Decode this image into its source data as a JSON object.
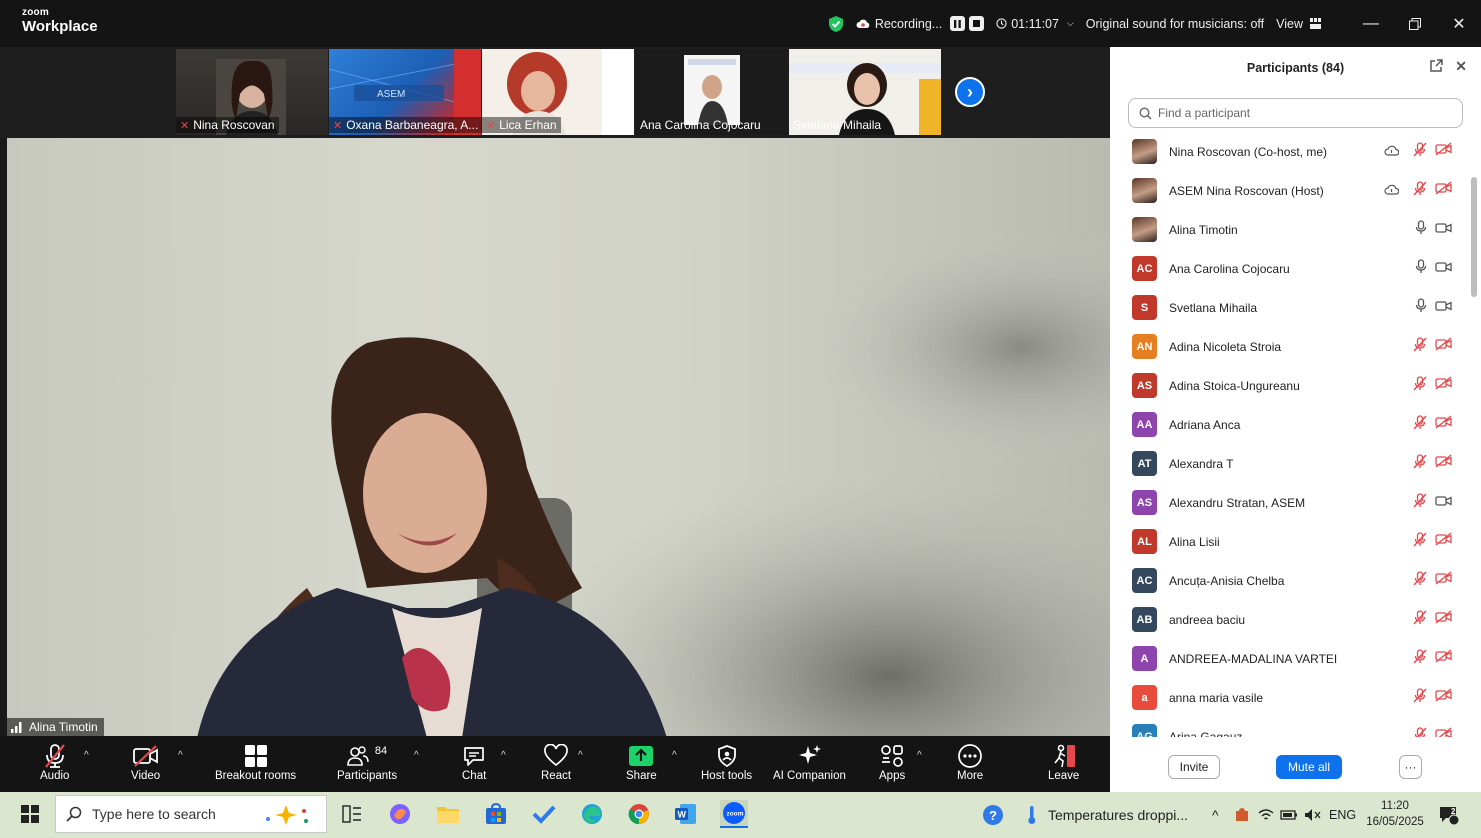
{
  "titlebar": {
    "brand_small": "zoom",
    "brand_big": "Workplace",
    "recording_label": "Recording...",
    "timer": "01:11:07",
    "sound_label": "Original sound for musicians: off",
    "view_label": "View"
  },
  "thumbnails": [
    {
      "label": "Nina Roscovan",
      "muted": true
    },
    {
      "label": "Oxana Barbaneagra, A...",
      "muted": true
    },
    {
      "label": "Lica Erhan",
      "muted": true
    },
    {
      "label": "Ana Carolina Cojocaru",
      "muted": false
    },
    {
      "label": "Svetlana Mihaila",
      "muted": false
    }
  ],
  "thumb_logo_text": "ASEM",
  "main_video": {
    "speaker": "Alina Timotin"
  },
  "toolbar": {
    "audio": "Audio",
    "video": "Video",
    "breakout": "Breakout rooms",
    "participants": "Participants",
    "participants_count": "84",
    "chat": "Chat",
    "react": "React",
    "share": "Share",
    "host_tools": "Host tools",
    "ai_companion": "AI Companion",
    "apps": "Apps",
    "more": "More",
    "leave": "Leave"
  },
  "panel": {
    "title": "Participants (84)",
    "search_placeholder": "Find a participant",
    "invite": "Invite",
    "mute_all": "Mute all",
    "more": "···",
    "participants": [
      {
        "name": "Nina Roscovan (Co-host, me)",
        "initials": "",
        "color": "",
        "photo": true,
        "cloud": true,
        "mic": "off",
        "cam": "off"
      },
      {
        "name": "ASEM Nina Roscovan (Host)",
        "initials": "",
        "color": "",
        "photo": true,
        "cloud": true,
        "mic": "off",
        "cam": "off"
      },
      {
        "name": "Alina Timotin",
        "initials": "",
        "color": "",
        "photo": true,
        "cloud": false,
        "mic": "on",
        "cam": "on"
      },
      {
        "name": "Ana Carolina Cojocaru",
        "initials": "AC",
        "color": "#c0392b",
        "photo": false,
        "cloud": false,
        "mic": "on",
        "cam": "on"
      },
      {
        "name": "Svetlana Mihaila",
        "initials": "S",
        "color": "#c0392b",
        "photo": false,
        "cloud": false,
        "mic": "on",
        "cam": "on"
      },
      {
        "name": "Adina Nicoleta Stroia",
        "initials": "AN",
        "color": "#e67e22",
        "photo": false,
        "cloud": false,
        "mic": "off",
        "cam": "off"
      },
      {
        "name": "Adina Stoica-Ungureanu",
        "initials": "AS",
        "color": "#c0392b",
        "photo": false,
        "cloud": false,
        "mic": "off",
        "cam": "off"
      },
      {
        "name": "Adriana Anca",
        "initials": "AA",
        "color": "#8e44ad",
        "photo": false,
        "cloud": false,
        "mic": "off",
        "cam": "off"
      },
      {
        "name": "Alexandra T",
        "initials": "AT",
        "color": "#34495e",
        "photo": false,
        "cloud": false,
        "mic": "off",
        "cam": "off"
      },
      {
        "name": "Alexandru Stratan, ASEM",
        "initials": "AS",
        "color": "#8e44ad",
        "photo": false,
        "cloud": false,
        "mic": "off",
        "cam": "on"
      },
      {
        "name": "Alina Lisii",
        "initials": "AL",
        "color": "#c0392b",
        "photo": false,
        "cloud": false,
        "mic": "off",
        "cam": "off"
      },
      {
        "name": "Ancuța-Anisia Chelba",
        "initials": "AC",
        "color": "#34495e",
        "photo": false,
        "cloud": false,
        "mic": "off",
        "cam": "off"
      },
      {
        "name": "andreea baciu",
        "initials": "AB",
        "color": "#34495e",
        "photo": false,
        "cloud": false,
        "mic": "off",
        "cam": "off"
      },
      {
        "name": "ANDREEA-MADALINA VARTEI",
        "initials": "A",
        "color": "#8e44ad",
        "photo": false,
        "cloud": false,
        "mic": "off",
        "cam": "off"
      },
      {
        "name": "anna maria vasile",
        "initials": "a",
        "color": "#e74c3c",
        "photo": false,
        "cloud": false,
        "mic": "off",
        "cam": "off"
      },
      {
        "name": "Arina Gagauz",
        "initials": "AG",
        "color": "#2980b9",
        "photo": false,
        "cloud": false,
        "mic": "off",
        "cam": "off"
      }
    ]
  },
  "taskbar": {
    "search_placeholder": "Type here to search",
    "weather": "Temperatures droppi...",
    "lang": "ENG",
    "time": "11:20",
    "date": "16/05/2025",
    "notif_count": "2"
  },
  "colors": {
    "accent": "#0e72ed",
    "muted_red": "#e5484d",
    "share_green": "#1cd36a",
    "dark_bg": "#141414"
  }
}
